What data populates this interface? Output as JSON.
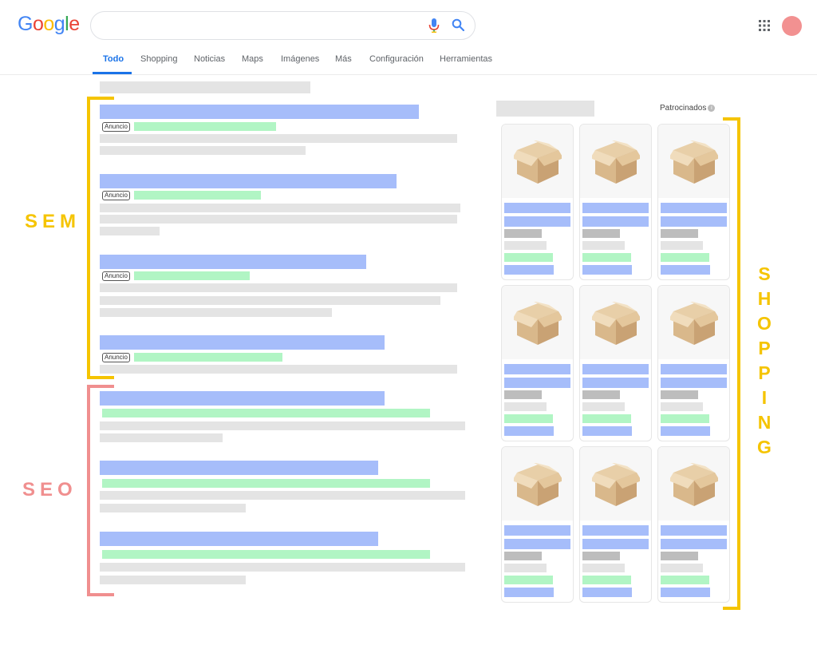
{
  "header": {
    "logo_letters": [
      {
        "ch": "G",
        "color": "#4285f4"
      },
      {
        "ch": "o",
        "color": "#ea4335"
      },
      {
        "ch": "o",
        "color": "#fbbc05"
      },
      {
        "ch": "g",
        "color": "#4285f4"
      },
      {
        "ch": "l",
        "color": "#34a853"
      },
      {
        "ch": "e",
        "color": "#ea4335"
      }
    ],
    "search_value": "",
    "icons": {
      "mic": "microphone-icon",
      "search": "search-icon",
      "apps": "apps-grid-icon",
      "avatar": "avatar"
    }
  },
  "tabs": [
    {
      "label": "Todo",
      "active": true
    },
    {
      "label": "Shopping",
      "active": false
    },
    {
      "label": "Noticias",
      "active": false
    },
    {
      "label": "Maps",
      "active": false
    },
    {
      "label": "Imágenes",
      "active": false
    },
    {
      "label": "Más",
      "active": false
    },
    {
      "label": "Configuración",
      "active": false
    },
    {
      "label": "Herramientas",
      "active": false
    }
  ],
  "ad_badge": "Anuncio",
  "sponsored_label": "Patrocinados",
  "section_labels": {
    "sem": "SEM",
    "seo": "SEO",
    "shopping": "SHOPPING"
  },
  "colors": {
    "sem_accent": "#f5c400",
    "seo_accent": "#f08f8f",
    "shopping_accent": "#f5c400",
    "title_placeholder": "#a6bdfa",
    "url_placeholder": "#b1f5c4",
    "text_placeholder": "#e4e4e4",
    "tab_active": "#1a73e8"
  }
}
